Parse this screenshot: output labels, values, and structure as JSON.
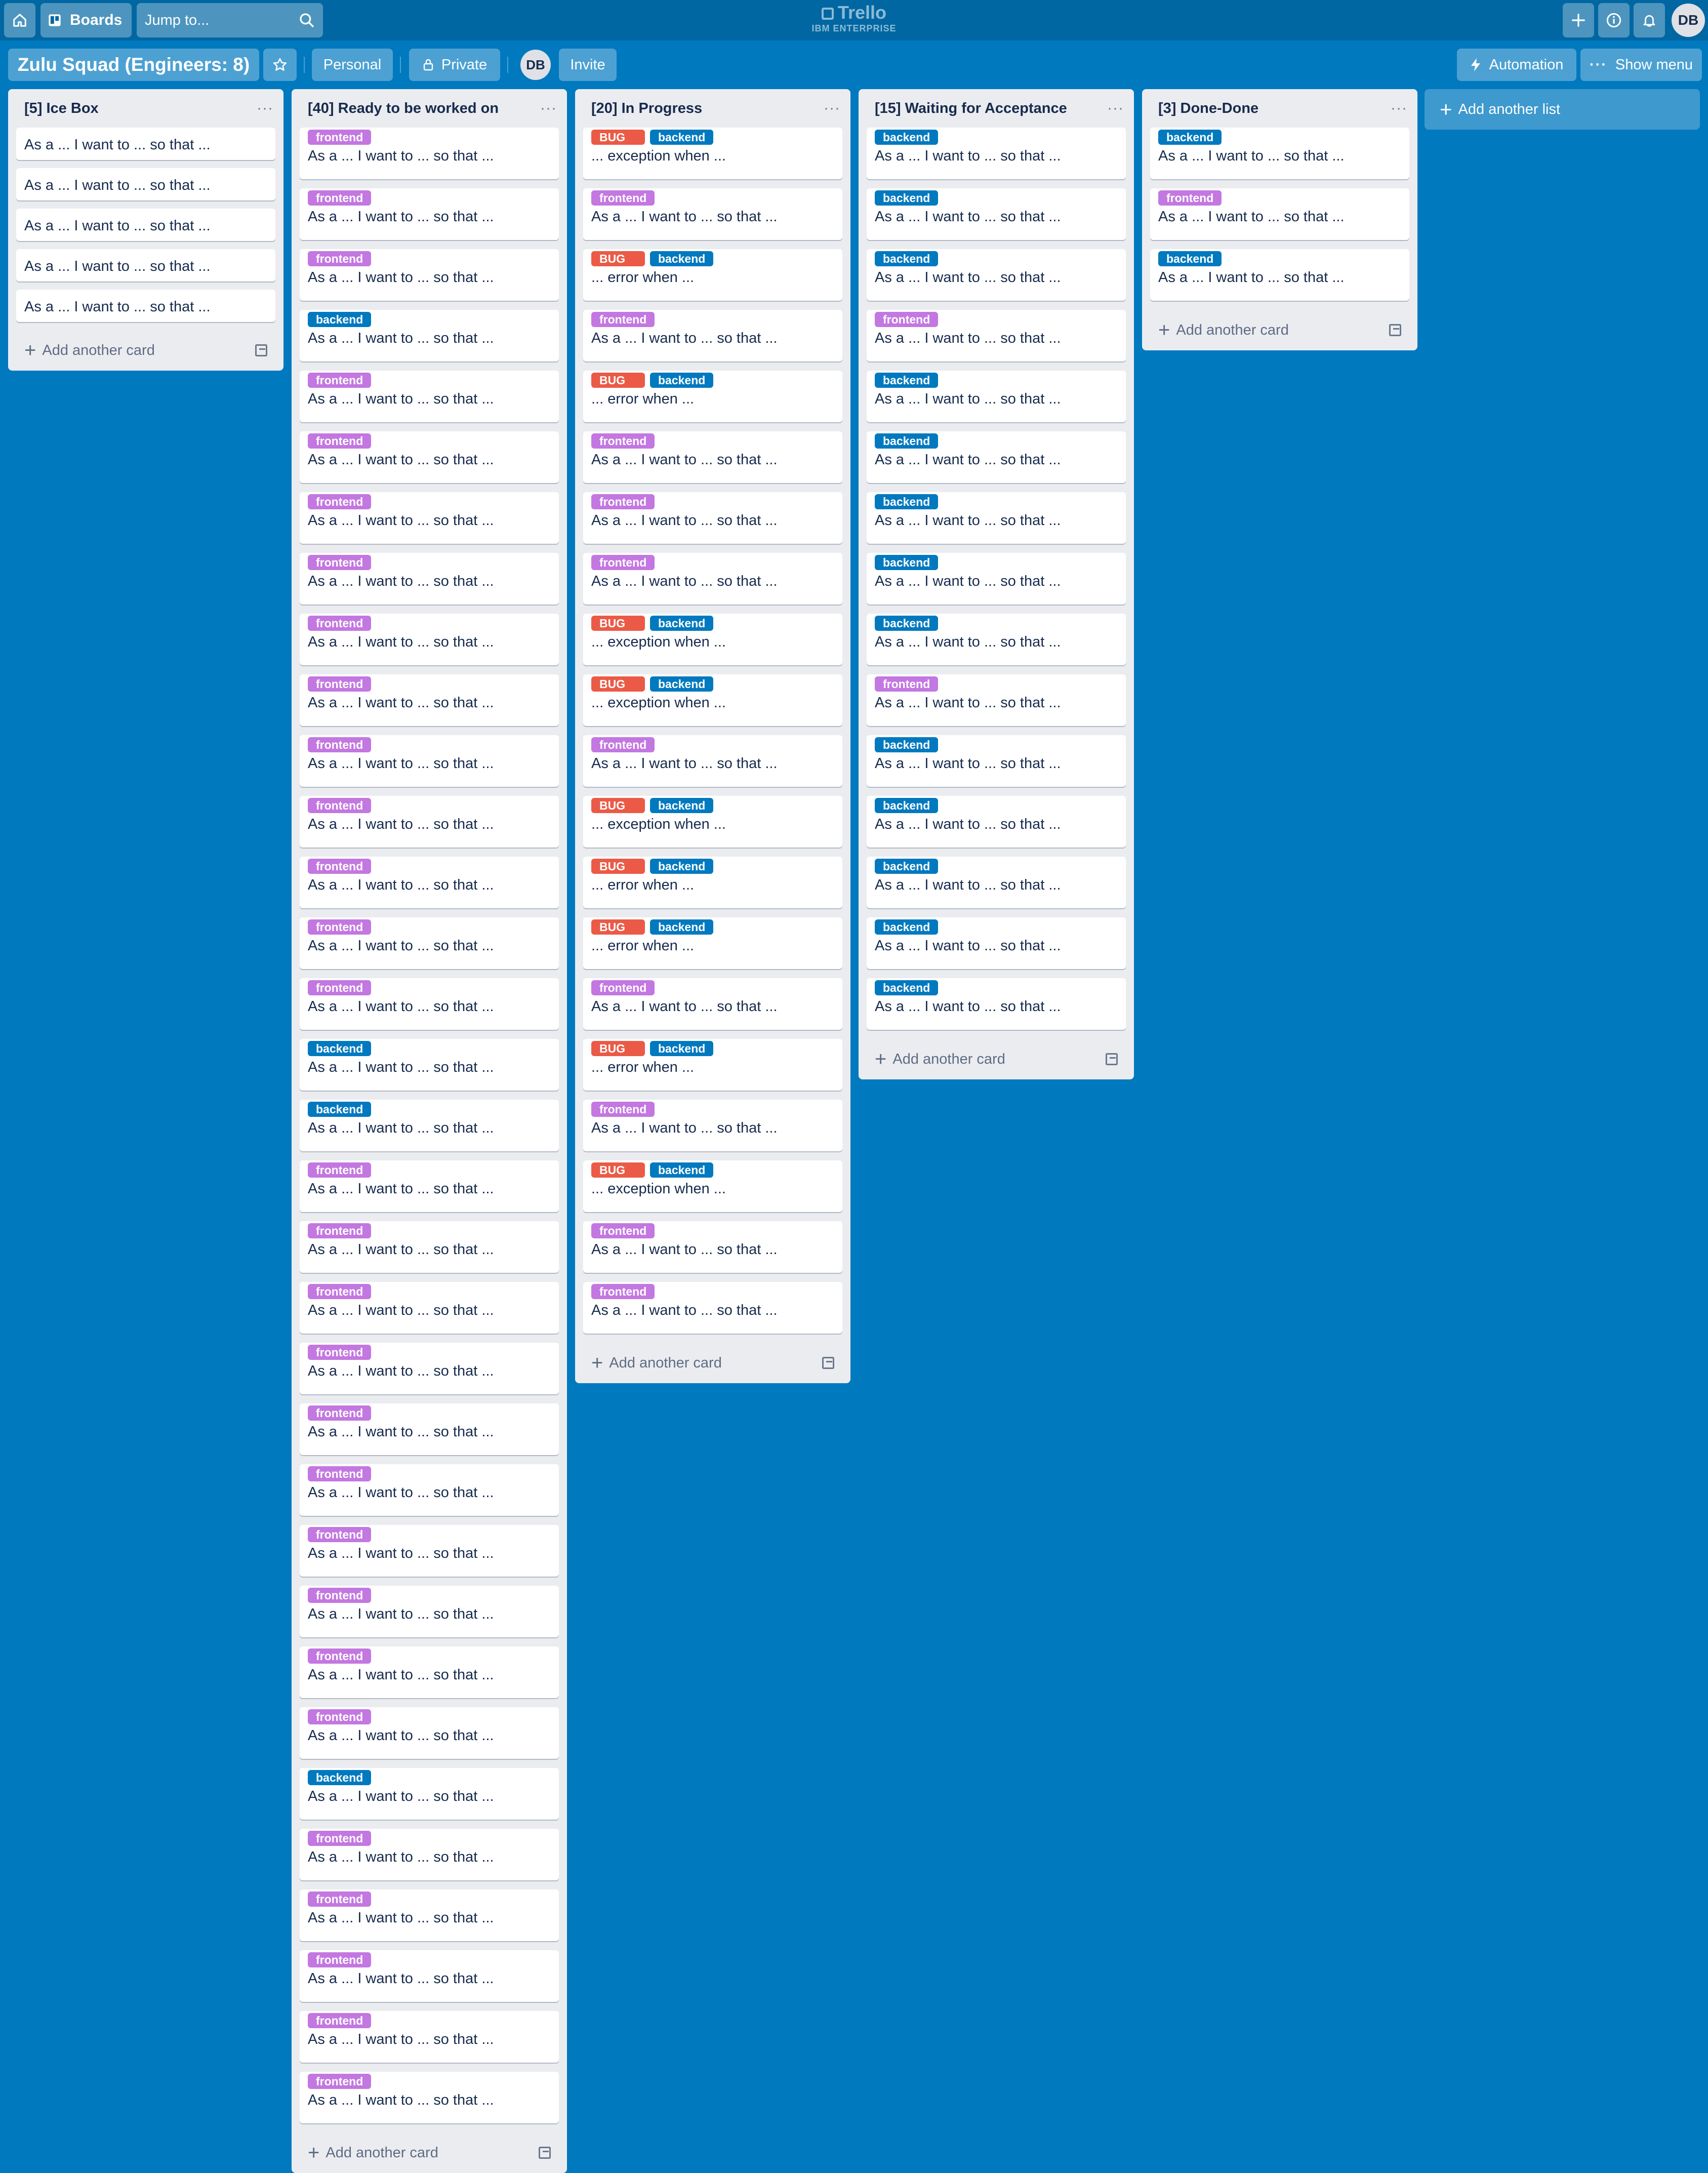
{
  "header": {
    "boards_label": "Boards",
    "jump_placeholder": "Jump to...",
    "logo_name": "Trello",
    "logo_sub": "IBM ENTERPRISE",
    "avatar": "DB"
  },
  "board": {
    "title": "Zulu Squad (Engineers: 8)",
    "personal": "Personal",
    "private": "Private",
    "member": "DB",
    "invite": "Invite",
    "automation": "Automation",
    "show_menu": "Show menu",
    "add_list": "Add another list"
  },
  "lists": [
    {
      "title": "[5] Ice Box",
      "add_card": "Add another card",
      "cards": [
        {
          "labels": [],
          "text": "As a ... I want to ... so that ..."
        },
        {
          "labels": [],
          "text": "As a ... I want to ... so that ..."
        },
        {
          "labels": [],
          "text": "As a ... I want to ... so that ..."
        },
        {
          "labels": [],
          "text": "As a ... I want to ... so that ..."
        },
        {
          "labels": [],
          "text": "As a ... I want to ... so that ..."
        }
      ]
    },
    {
      "title": "[40] Ready to be worked on",
      "add_card": "Add another card",
      "cards": [
        {
          "labels": [
            "frontend"
          ],
          "text": "As a ... I want to ... so that ..."
        },
        {
          "labels": [
            "frontend"
          ],
          "text": "As a ... I want to ... so that ..."
        },
        {
          "labels": [
            "frontend"
          ],
          "text": "As a ... I want to ... so that ..."
        },
        {
          "labels": [
            "backend"
          ],
          "text": "As a ... I want to ... so that ..."
        },
        {
          "labels": [
            "frontend"
          ],
          "text": "As a ... I want to ... so that ..."
        },
        {
          "labels": [
            "frontend"
          ],
          "text": "As a ... I want to ... so that ..."
        },
        {
          "labels": [
            "frontend"
          ],
          "text": "As a ... I want to ... so that ..."
        },
        {
          "labels": [
            "frontend"
          ],
          "text": "As a ... I want to ... so that ..."
        },
        {
          "labels": [
            "frontend"
          ],
          "text": "As a ... I want to ... so that ..."
        },
        {
          "labels": [
            "frontend"
          ],
          "text": "As a ... I want to ... so that ..."
        },
        {
          "labels": [
            "frontend"
          ],
          "text": "As a ... I want to ... so that ..."
        },
        {
          "labels": [
            "frontend"
          ],
          "text": "As a ... I want to ... so that ..."
        },
        {
          "labels": [
            "frontend"
          ],
          "text": "As a ... I want to ... so that ..."
        },
        {
          "labels": [
            "frontend"
          ],
          "text": "As a ... I want to ... so that ..."
        },
        {
          "labels": [
            "frontend"
          ],
          "text": "As a ... I want to ... so that ..."
        },
        {
          "labels": [
            "backend"
          ],
          "text": "As a ... I want to ... so that ..."
        },
        {
          "labels": [
            "backend"
          ],
          "text": "As a ... I want to ... so that ..."
        },
        {
          "labels": [
            "frontend"
          ],
          "text": "As a ... I want to ... so that ..."
        },
        {
          "labels": [
            "frontend"
          ],
          "text": "As a ... I want to ... so that ..."
        },
        {
          "labels": [
            "frontend"
          ],
          "text": "As a ... I want to ... so that ..."
        },
        {
          "labels": [
            "frontend"
          ],
          "text": "As a ... I want to ... so that ..."
        },
        {
          "labels": [
            "frontend"
          ],
          "text": "As a ... I want to ... so that ..."
        },
        {
          "labels": [
            "frontend"
          ],
          "text": "As a ... I want to ... so that ..."
        },
        {
          "labels": [
            "frontend"
          ],
          "text": "As a ... I want to ... so that ..."
        },
        {
          "labels": [
            "frontend"
          ],
          "text": "As a ... I want to ... so that ..."
        },
        {
          "labels": [
            "frontend"
          ],
          "text": "As a ... I want to ... so that ..."
        },
        {
          "labels": [
            "frontend"
          ],
          "text": "As a ... I want to ... so that ..."
        },
        {
          "labels": [
            "backend"
          ],
          "text": "As a ... I want to ... so that ..."
        },
        {
          "labels": [
            "frontend"
          ],
          "text": "As a ... I want to ... so that ..."
        },
        {
          "labels": [
            "frontend"
          ],
          "text": "As a ... I want to ... so that ..."
        },
        {
          "labels": [
            "frontend"
          ],
          "text": "As a ... I want to ... so that ..."
        },
        {
          "labels": [
            "frontend"
          ],
          "text": "As a ... I want to ... so that ..."
        },
        {
          "labels": [
            "frontend"
          ],
          "text": "As a ... I want to ... so that ..."
        }
      ]
    },
    {
      "title": "[20] In Progress",
      "add_card": "Add another card",
      "cards": [
        {
          "labels": [
            "BUG",
            "backend"
          ],
          "text": "... exception when ..."
        },
        {
          "labels": [
            "frontend"
          ],
          "text": "As a ... I want to ... so that ..."
        },
        {
          "labels": [
            "BUG",
            "backend"
          ],
          "text": "... error when ..."
        },
        {
          "labels": [
            "frontend"
          ],
          "text": "As a ... I want to ... so that ..."
        },
        {
          "labels": [
            "BUG",
            "backend"
          ],
          "text": "... error when ..."
        },
        {
          "labels": [
            "frontend"
          ],
          "text": "As a ... I want to ... so that ..."
        },
        {
          "labels": [
            "frontend"
          ],
          "text": "As a ... I want to ... so that ..."
        },
        {
          "labels": [
            "frontend"
          ],
          "text": "As a ... I want to ... so that ..."
        },
        {
          "labels": [
            "BUG",
            "backend"
          ],
          "text": "... exception when ..."
        },
        {
          "labels": [
            "BUG",
            "backend"
          ],
          "text": "... exception when ..."
        },
        {
          "labels": [
            "frontend"
          ],
          "text": "As a ... I want to ... so that ..."
        },
        {
          "labels": [
            "BUG",
            "backend"
          ],
          "text": "... exception when ..."
        },
        {
          "labels": [
            "BUG",
            "backend"
          ],
          "text": "... error when ..."
        },
        {
          "labels": [
            "BUG",
            "backend"
          ],
          "text": "... error when ..."
        },
        {
          "labels": [
            "frontend"
          ],
          "text": "As a ... I want to ... so that ..."
        },
        {
          "labels": [
            "BUG",
            "backend"
          ],
          "text": "... error when ..."
        },
        {
          "labels": [
            "frontend"
          ],
          "text": "As a ... I want to ... so that ..."
        },
        {
          "labels": [
            "BUG",
            "backend"
          ],
          "text": "... exception when ..."
        },
        {
          "labels": [
            "frontend"
          ],
          "text": "As a ... I want to ... so that ..."
        },
        {
          "labels": [
            "frontend"
          ],
          "text": "As a ... I want to ... so that ..."
        }
      ]
    },
    {
      "title": "[15] Waiting for Acceptance",
      "add_card": "Add another card",
      "cards": [
        {
          "labels": [
            "backend"
          ],
          "text": "As a ... I want to ... so that ..."
        },
        {
          "labels": [
            "backend"
          ],
          "text": "As a ... I want to ... so that ..."
        },
        {
          "labels": [
            "backend"
          ],
          "text": "As a ... I want to ... so that ..."
        },
        {
          "labels": [
            "frontend"
          ],
          "text": "As a ... I want to ... so that ..."
        },
        {
          "labels": [
            "backend"
          ],
          "text": "As a ... I want to ... so that ..."
        },
        {
          "labels": [
            "backend"
          ],
          "text": "As a ... I want to ... so that ..."
        },
        {
          "labels": [
            "backend"
          ],
          "text": "As a ... I want to ... so that ..."
        },
        {
          "labels": [
            "backend"
          ],
          "text": "As a ... I want to ... so that ..."
        },
        {
          "labels": [
            "backend"
          ],
          "text": "As a ... I want to ... so that ..."
        },
        {
          "labels": [
            "frontend"
          ],
          "text": "As a ... I want to ... so that ..."
        },
        {
          "labels": [
            "backend"
          ],
          "text": "As a ... I want to ... so that ..."
        },
        {
          "labels": [
            "backend"
          ],
          "text": "As a ... I want to ... so that ..."
        },
        {
          "labels": [
            "backend"
          ],
          "text": "As a ... I want to ... so that ..."
        },
        {
          "labels": [
            "backend"
          ],
          "text": "As a ... I want to ... so that ..."
        },
        {
          "labels": [
            "backend"
          ],
          "text": "As a ... I want to ... so that ..."
        }
      ]
    },
    {
      "title": "[3] Done-Done",
      "add_card": "Add another card",
      "cards": [
        {
          "labels": [
            "backend"
          ],
          "text": "As a ... I want to ... so that ..."
        },
        {
          "labels": [
            "frontend"
          ],
          "text": "As a ... I want to ... so that ..."
        },
        {
          "labels": [
            "backend"
          ],
          "text": "As a ... I want to ... so that ..."
        }
      ]
    }
  ],
  "colors": {
    "board_bg": "#0079bf",
    "label_frontend": "#c377e0",
    "label_backend": "#0079bf",
    "label_bug": "#eb5a46"
  }
}
